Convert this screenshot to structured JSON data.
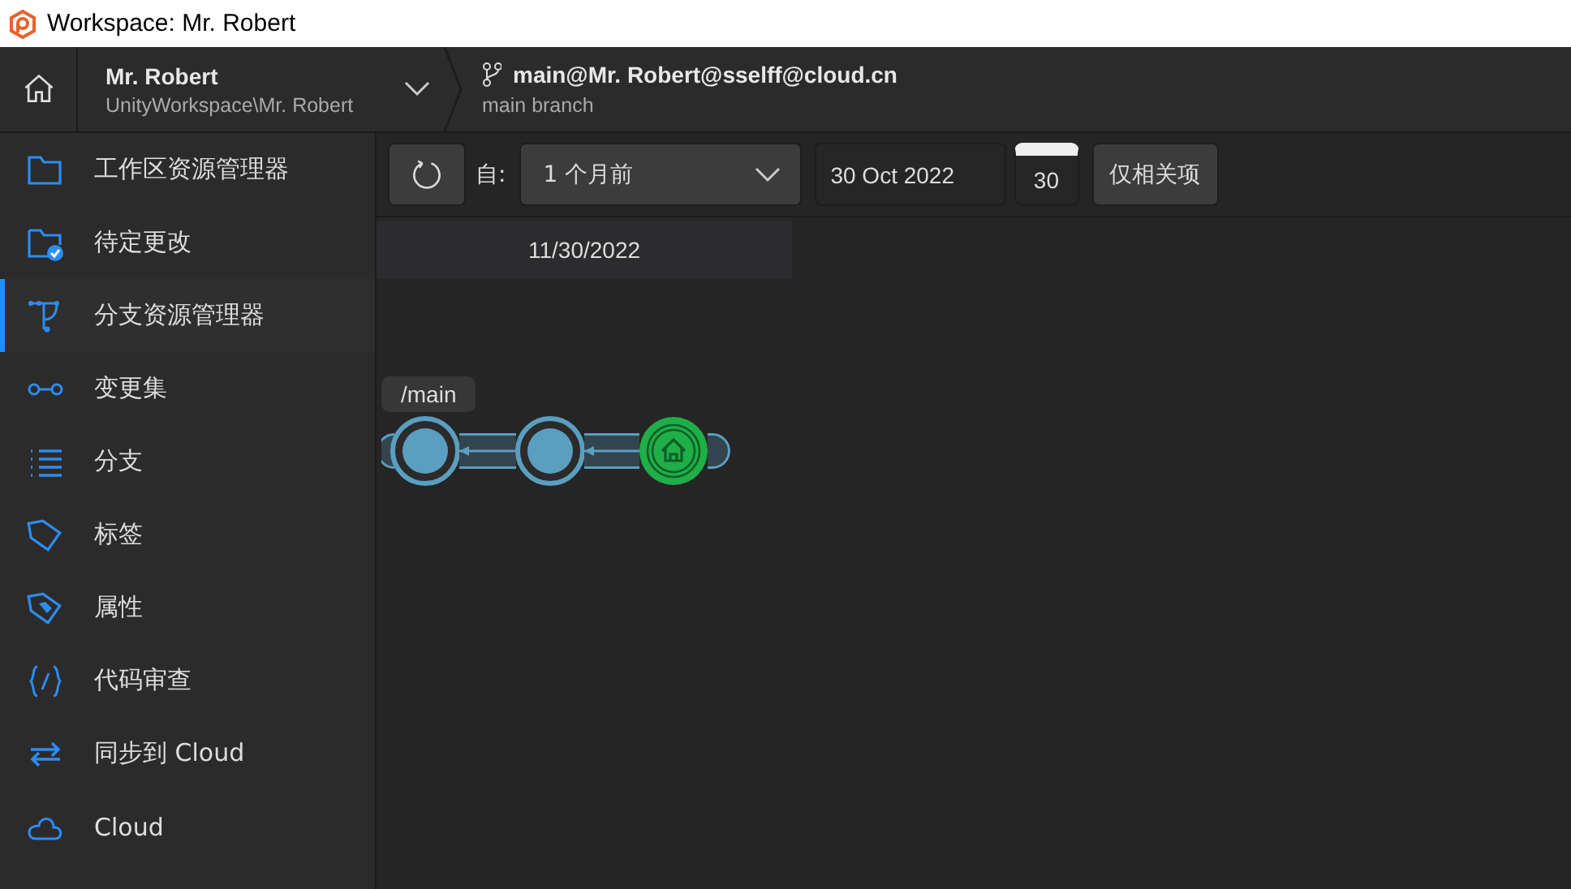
{
  "window": {
    "title": "Workspace: Mr. Robert"
  },
  "workspace": {
    "name": "Mr. Robert",
    "path": "UnityWorkspace\\Mr. Robert"
  },
  "branch": {
    "title": "main@Mr. Robert@sselff@cloud.cn",
    "subtitle": "main branch"
  },
  "sidebar": {
    "items": [
      {
        "label": "工作区资源管理器",
        "selected": false
      },
      {
        "label": "待定更改",
        "selected": false
      },
      {
        "label": "分支资源管理器",
        "selected": true
      },
      {
        "label": "变更集",
        "selected": false
      },
      {
        "label": "分支",
        "selected": false
      },
      {
        "label": "标签",
        "selected": false
      },
      {
        "label": "属性",
        "selected": false
      },
      {
        "label": "代码审查",
        "selected": false
      },
      {
        "label": "同步到 Cloud",
        "selected": false
      },
      {
        "label": "Cloud",
        "selected": false
      }
    ]
  },
  "toolbar": {
    "from_label": "自:",
    "range": "1 个月前",
    "date": "30 Oct 2022",
    "calendar_day": "30",
    "filter_button": "仅相关项"
  },
  "timeline": {
    "date_header": "11/30/2022",
    "branch_label": "/main",
    "changesets": [
      {
        "kind": "changeset"
      },
      {
        "kind": "changeset"
      },
      {
        "kind": "home"
      }
    ]
  }
}
